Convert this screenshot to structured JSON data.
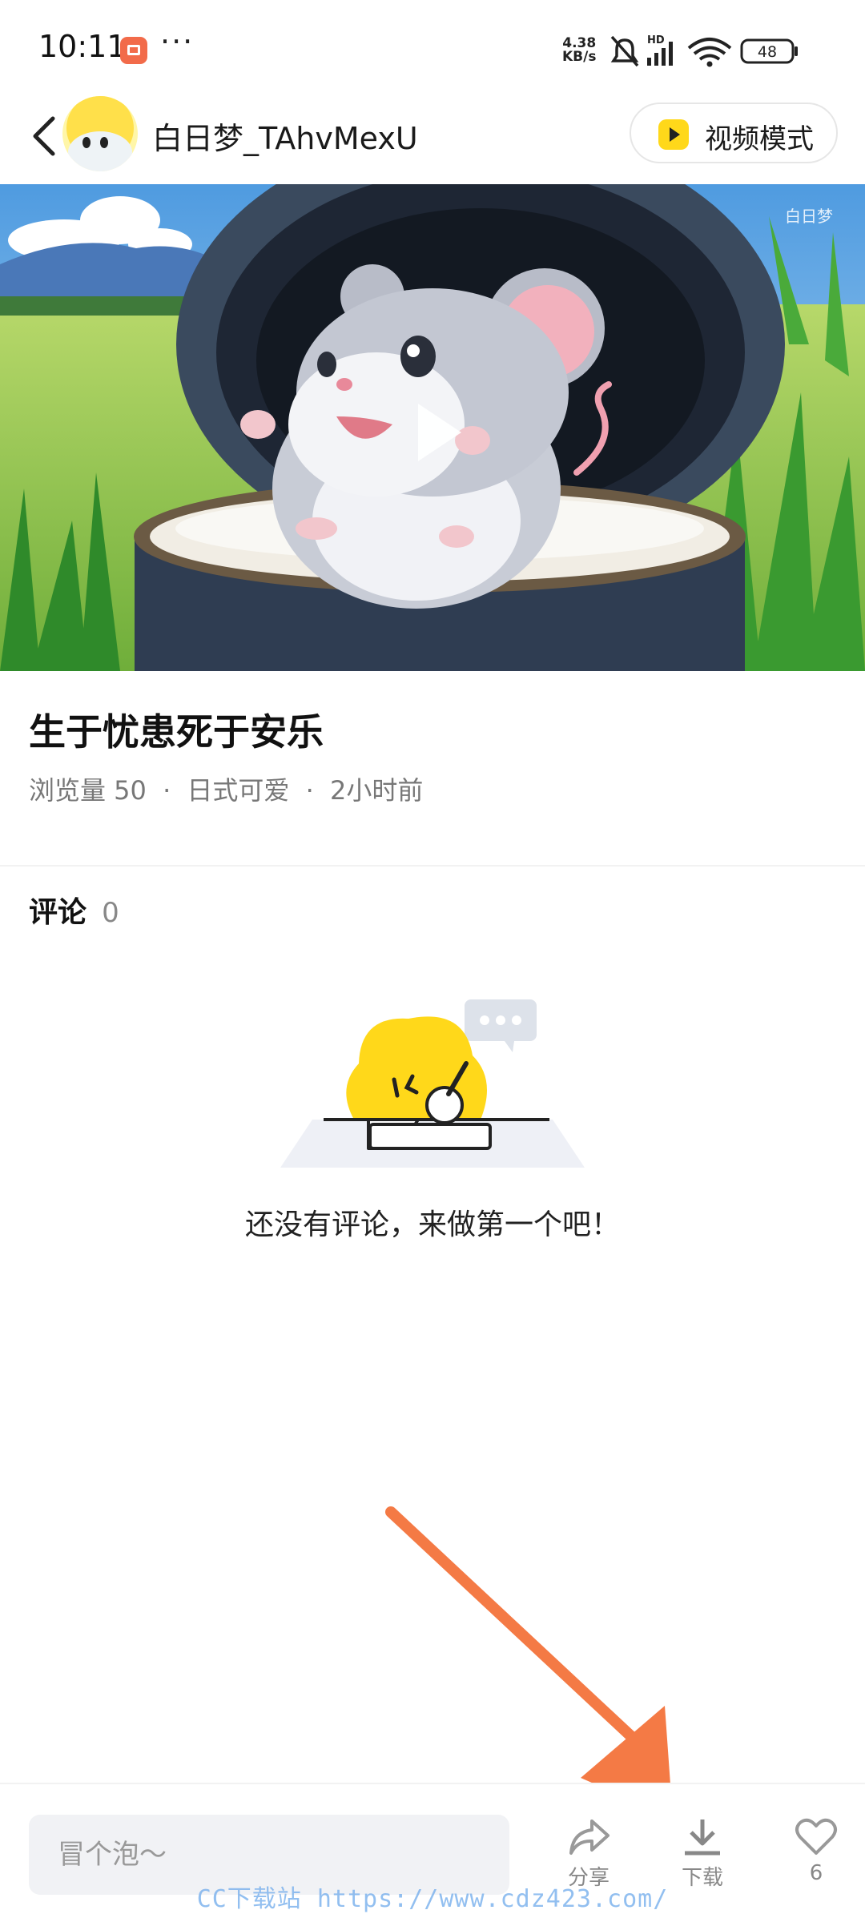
{
  "status_bar": {
    "time": "10:11",
    "more": "···",
    "net_speed_value": "4.38",
    "net_speed_unit": "KB/s",
    "hd_label": "HD",
    "battery": "48"
  },
  "header": {
    "username": "白日梦_TAhvMexU",
    "video_mode_label": "视频模式"
  },
  "media": {
    "watermark": "白日梦",
    "illustration": "cartoon-mouse-in-rice-barrel"
  },
  "post": {
    "title": "生于忧患死于安乐",
    "views_label": "浏览量 50",
    "style_tag": "日式可爱",
    "time_ago": "2小时前",
    "separator": "·"
  },
  "comments": {
    "label": "评论",
    "count": "0",
    "empty_text": "还没有评论，来做第一个吧！"
  },
  "bottom_bar": {
    "input_placeholder": "冒个泡～",
    "share_label": "分享",
    "download_label": "下载",
    "like_count": "6"
  },
  "overlay": {
    "site_watermark": "CC下载站 https://www.cdz423.com/",
    "arrow_color": "#f47a45"
  },
  "colors": {
    "brand_yellow": "#ffd81a",
    "accent_orange": "#f26b4a",
    "muted_text": "#777777"
  }
}
